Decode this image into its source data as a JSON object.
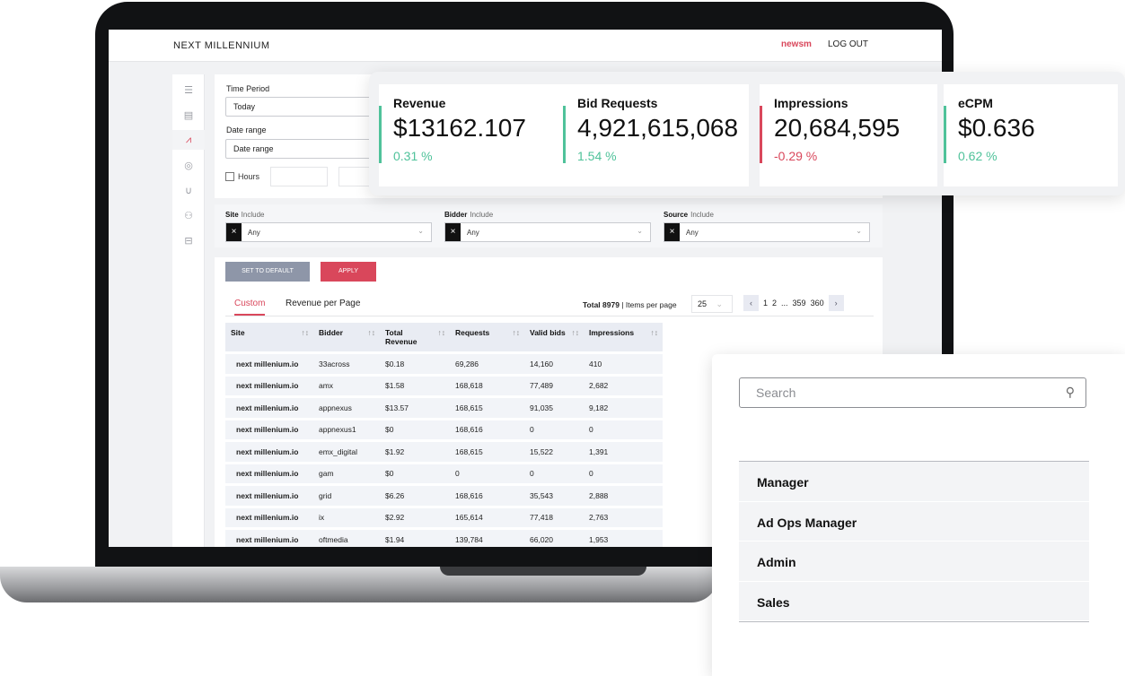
{
  "brand": {
    "logo": "NEXT MILLENNIUM"
  },
  "header": {
    "user": "newsm",
    "logout": "LOG OUT"
  },
  "nav_icons": [
    "menu-icon",
    "report-icon",
    "chart-icon",
    "coins-icon",
    "magnet-icon",
    "users-icon",
    "briefcase-icon"
  ],
  "filters": {
    "time_period_label": "Time Period",
    "time_period_value": "Today",
    "date_range_label": "Date range",
    "date_range_value": "Date range",
    "hours_label": "Hours"
  },
  "dimensions": {
    "site": {
      "label": "Site",
      "mode": "Include",
      "value": "Any"
    },
    "bidder": {
      "label": "Bidder",
      "mode": "Include",
      "value": "Any"
    },
    "source": {
      "label": "Source",
      "mode": "Include",
      "value": "Any"
    }
  },
  "actions": {
    "set_default": "SET TO DEFAULT",
    "apply": "APPLY"
  },
  "tabs": [
    "Custom",
    "Revenue per Page"
  ],
  "pagination": {
    "total_label": "Total 8979",
    "items_label": "| Items per page",
    "per_page": "25",
    "pages": [
      "1",
      "2",
      "...",
      "359",
      "360"
    ]
  },
  "table": {
    "headers": [
      "Site",
      "Bidder",
      "Total Revenue",
      "Requests",
      "Valid bids",
      "Impressions"
    ],
    "rows": [
      [
        "next millenium.io",
        "33across",
        "$0.18",
        "69,286",
        "14,160",
        "410"
      ],
      [
        "next millenium.io",
        "amx",
        "$1.58",
        "168,618",
        "77,489",
        "2,682"
      ],
      [
        "next millenium.io",
        "appnexus",
        "$13.57",
        "168,615",
        "91,035",
        "9,182"
      ],
      [
        "next millenium.io",
        "appnexus1",
        "$0",
        "168,616",
        "0",
        "0"
      ],
      [
        "next millenium.io",
        "emx_digital",
        "$1.92",
        "168,615",
        "15,522",
        "1,391"
      ],
      [
        "next millenium.io",
        "gam",
        "$0",
        "0",
        "0",
        "0"
      ],
      [
        "next millenium.io",
        "grid",
        "$6.26",
        "168,616",
        "35,543",
        "2,888"
      ],
      [
        "next millenium.io",
        "ix",
        "$2.92",
        "165,614",
        "77,418",
        "2,763"
      ],
      [
        "next millenium.io",
        "oftmedia",
        "$1.94",
        "139,784",
        "66,020",
        "1,953"
      ]
    ]
  },
  "stats": [
    {
      "title": "Revenue",
      "value": "$13162.107",
      "change": "0.31 %",
      "color": "#4fc29a"
    },
    {
      "title": "Bid Requests",
      "value": "4,921,615,068",
      "change": "1.54 %",
      "color": "#4fc29a"
    },
    {
      "title": "Impressions",
      "value": "20,684,595",
      "change": "-0.29 %",
      "color": "#d9475b"
    },
    {
      "title": "eCPM",
      "value": "$0.636",
      "change": "0.62 %",
      "color": "#4fc29a"
    }
  ],
  "roles": {
    "search_placeholder": "Search",
    "items": [
      "Manager",
      "Ad Ops Manager",
      "Admin",
      "Sales"
    ]
  }
}
